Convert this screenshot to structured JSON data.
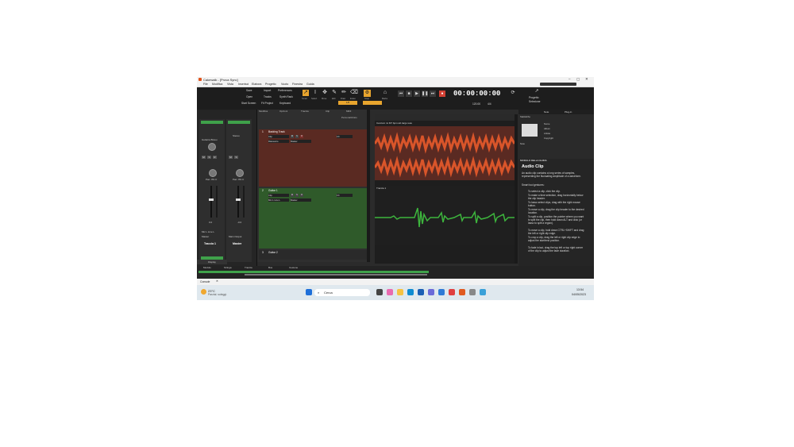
{
  "window": {
    "title": "Cakewalk - [Prova Sync]",
    "menu": [
      "File",
      "Modifica",
      "Vista",
      "Inserisci",
      "Elabora",
      "Progetto",
      "Vuoto",
      "Finestra",
      "Guida"
    ]
  },
  "control_bar": {
    "file_buttons": [
      "Save",
      "Open",
      "Start Screen",
      "Import",
      "Tracks",
      "Fit Project",
      "Preferences",
      "Synth Rack",
      "Keyboard"
    ],
    "tools": [
      "Smart",
      "Select",
      "Move",
      "Edit",
      "Draw",
      "Erase"
    ],
    "snap_label": "Snap",
    "snap_value": "1/8",
    "marks_label": "Marks",
    "timecode": "00:00:00:00",
    "tempo": "120.00",
    "meter": "4/4",
    "project_options": [
      "Progetto",
      "Selezione"
    ]
  },
  "console": {
    "strips": [
      {
        "name": "Traccia 1",
        "input": "Mic L Line L",
        "output": "Master",
        "pan": "Pan: 0% C",
        "vol": "0.0",
        "sub": "Guitarra Brasu"
      },
      {
        "name": "Master",
        "input": "Main Output",
        "output": "",
        "pan": "Pan: 0% C",
        "vol": "-0.0",
        "sub": "Stereo"
      }
    ],
    "display_label": "Display"
  },
  "tracks": {
    "menu": [
      "Modifica",
      "Opzioni",
      "Traccia",
      "Clip",
      "MIDI",
      "Regioni FX"
    ],
    "view_label": "Personalizzato",
    "items": [
      {
        "num": "1",
        "name": "Backing Track",
        "clip_label": "Clip",
        "input": "Riassunto",
        "output": "Master",
        "fx": "FX"
      },
      {
        "num": "2",
        "name": "Guitar 1",
        "clip_label": "Clip",
        "input": "Mic L Line L",
        "output": "Master",
        "fx": "FX"
      },
      {
        "num": "3",
        "name": "Guitar 2",
        "clip_label": "",
        "input": "",
        "output": "",
        "fx": ""
      }
    ]
  },
  "clips": [
    {
      "name": "Canzoni mi M7 bpm.wb largo.wav",
      "color": "#d9552a"
    },
    {
      "name": "Traccia 1",
      "color": "#3db53d"
    }
  ],
  "browser": {
    "tabs": [
      "Note",
      "Plug-in"
    ],
    "panel_title": "Statistiche",
    "meta_fields": [
      "Nome",
      "Album",
      "Artista",
      "Copyright"
    ],
    "note_label": "Note"
  },
  "help": {
    "title": "MODULO DELLA GUIDA",
    "heading": "Audio Clip",
    "intro": "An audio clip contains a long series of samples, representing the fluctuating amplitude of a waveform.",
    "subheading": "Smart tool gestures:",
    "bullets": [
      "To select a clip, click the clip.",
      "To make a time selection, drag horizontally below the clip header.",
      "To lasso select clips, drag with the right mouse button.",
      "To move a clip, drag the clip header to the desired location.",
      "To split a clip, position the pointer where you want to split the clip, then hold down ALT and click (or lasso to split a region).",
      "To move a clip, hold down CTRL+SHIFT and drag the left or right clip edge.",
      "To crop a clip, drag the left or right clip edge to adjust the start/end position.",
      "To fade in/out, drag the top left or top right corner of the clip to adjust the fade duration."
    ]
  },
  "bottom_tabs": [
    "Modulo",
    "Stringa",
    "Traccia",
    "Bus",
    "Cestone"
  ],
  "console_bar": "Console",
  "taskbar": {
    "temp": "23°C",
    "weather": "Parzial. soleggi.",
    "search": "Cerca",
    "time": "13:54",
    "date": "04/05/2023"
  },
  "colors": {
    "accent": "#e8a52e",
    "track_red": "#5a2a22",
    "track_green": "#2f5a2a",
    "wave_red": "#d9552a",
    "wave_green": "#3db53d"
  }
}
